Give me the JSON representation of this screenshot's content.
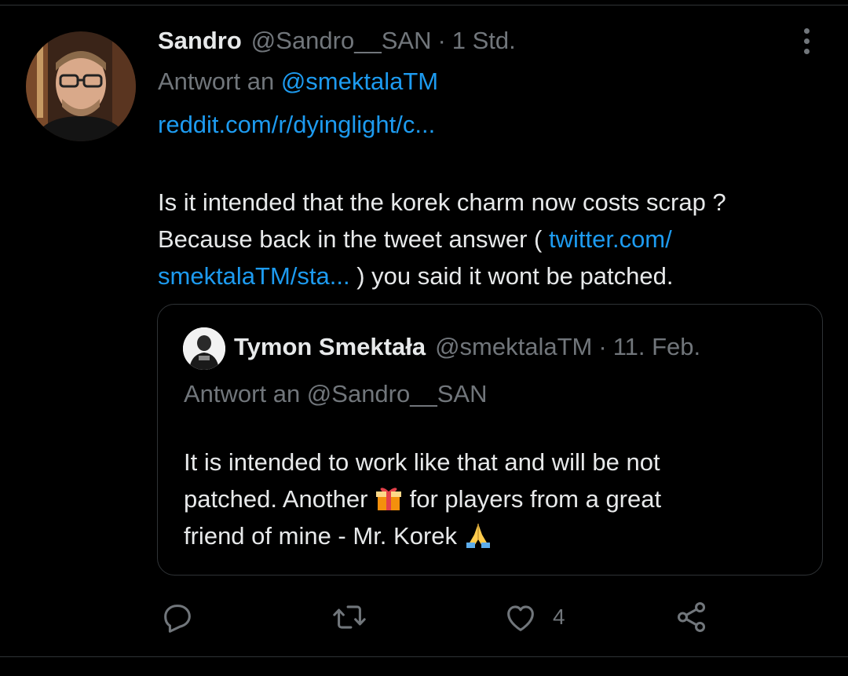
{
  "tweet": {
    "author_name": "Sandro",
    "author_handle": "@Sandro__SAN",
    "separator": "·",
    "time": "1 Std.",
    "reply_prefix": "Antwort an",
    "reply_to": "@smektalaTM",
    "link": "reddit.com/r/dyinglight/c...",
    "text": {
      "line1": "Is it intended that the korek charm now costs scrap ?",
      "line2_before": "Because back in the tweet answer ( ",
      "line2_link": "twitter.com/",
      "line3_link": "smektalaTM/sta...",
      "line3_after": " ) you said it wont be patched."
    }
  },
  "quoted_tweet": {
    "author_name": "Tymon Smektała",
    "author_handle": "@smektalaTM",
    "separator": "·",
    "time": "11. Feb.",
    "reply_text": "Antwort an @Sandro__SAN",
    "text": {
      "line1": "It is intended to work like that and will be not",
      "line2_before": "patched. Another ",
      "line2_emoji": "gift-emoji",
      "line2_after": " for players from a great",
      "line3_before": "friend of mine - Mr. Korek ",
      "line3_emoji": "folded-hands-emoji"
    }
  },
  "actions": {
    "reply_icon": "reply-icon",
    "retweet_icon": "retweet-icon",
    "like_icon": "heart-icon",
    "like_count": "4",
    "share_icon": "share-icon"
  },
  "colors": {
    "background": "#000000",
    "text": "#e7e9ea",
    "secondary": "#71767b",
    "link": "#1d9bf0",
    "border": "#2f3336"
  }
}
